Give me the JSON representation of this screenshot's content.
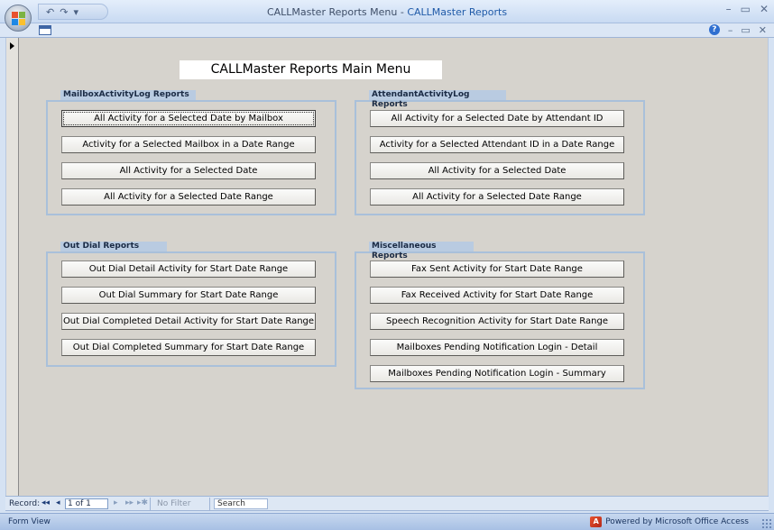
{
  "window": {
    "title": "CALLMaster Reports Menu",
    "title_separator": " - ",
    "subtitle": "CALLMaster Reports",
    "controls": [
      "–",
      "▭",
      "✕"
    ]
  },
  "quick_access": {
    "undo": "↶",
    "redo": "↷",
    "customize": "▾"
  },
  "mdi_controls": {
    "help": "?",
    "minimize": "–",
    "restore": "▭",
    "close": "✕"
  },
  "form": {
    "title": "CALLMaster Reports Main Menu",
    "groups": [
      {
        "label": "MailboxActivityLog Reports",
        "buttons": [
          "All Activity for a Selected Date by Mailbox",
          "Activity for a Selected Mailbox in a Date Range",
          "All Activity for a Selected Date",
          "All Activity for a Selected Date Range"
        ]
      },
      {
        "label": "AttendantActivityLog Reports",
        "buttons": [
          "All Activity for a Selected Date by Attendant ID",
          "Activity for a Selected Attendant ID in a Date Range",
          "All Activity for a Selected Date",
          "All Activity for a Selected Date Range"
        ]
      },
      {
        "label": "Out Dial Reports",
        "buttons": [
          "Out Dial Detail Activity for Start Date Range",
          "Out Dial Summary for Start Date Range",
          "Out Dial Completed Detail Activity for Start Date Range",
          "Out Dial Completed Summary for Start Date Range"
        ]
      },
      {
        "label": "Miscellaneous Reports",
        "buttons": [
          "Fax Sent Activity for Start Date Range",
          "Fax Received Activity for Start Date Range",
          "Speech Recognition Activity for Start Date Range",
          "Mailboxes Pending Notification Login - Detail",
          "Mailboxes Pending Notification Login - Summary"
        ]
      }
    ]
  },
  "record_nav": {
    "label": "Record:",
    "first": "◂◂",
    "prev": "◂",
    "count": "1 of 1",
    "next": "▸",
    "last": "▸▸",
    "new": "▸✱",
    "filter": "No Filter",
    "search": "Search"
  },
  "status": {
    "view": "Form View",
    "branding": "Powered by Microsoft Office Access"
  }
}
